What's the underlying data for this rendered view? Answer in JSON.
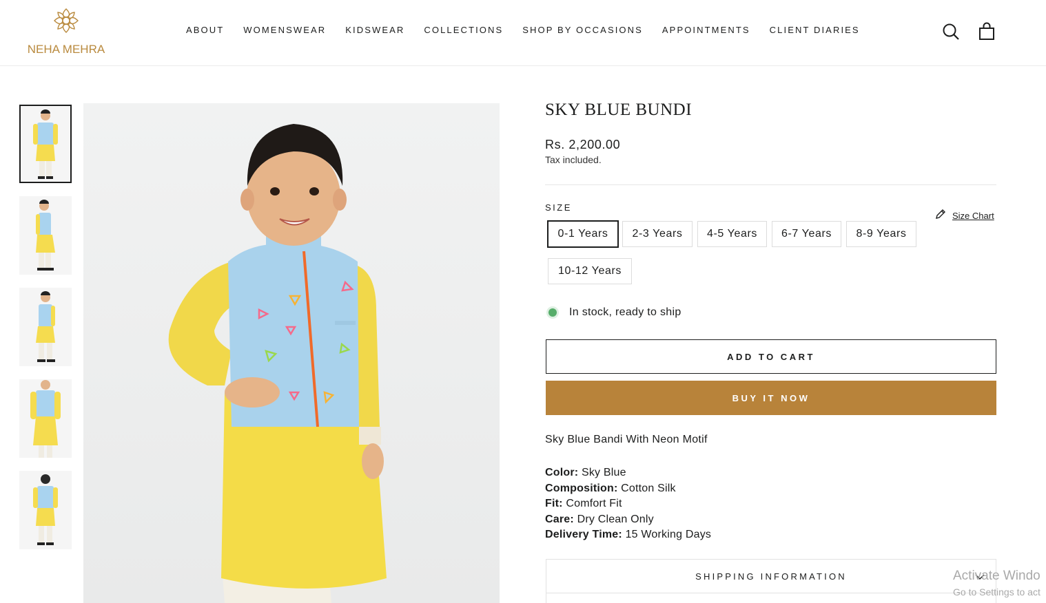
{
  "brand": {
    "name": "NEHA MEHRA",
    "accent": "#b8833a"
  },
  "nav": {
    "items": [
      "ABOUT",
      "WOMENSWEAR",
      "KIDSWEAR",
      "COLLECTIONS",
      "SHOP BY OCCASIONS",
      "APPOINTMENTS",
      "CLIENT DIARIES"
    ]
  },
  "header_icons": {
    "search": "search-icon",
    "cart": "cart-icon"
  },
  "gallery": {
    "thumbnail_count": 5,
    "active_index": 0
  },
  "product": {
    "title": "SKY BLUE BUNDI",
    "price": "Rs. 2,200.00",
    "tax_note": "Tax included.",
    "size_label": "SIZE",
    "size_chart_label": "Size Chart",
    "sizes": [
      "0-1 Years",
      "2-3 Years",
      "4-5 Years",
      "6-7 Years",
      "8-9 Years",
      "10-12 Years"
    ],
    "selected_size": "0-1 Years",
    "stock_text": "In stock, ready to ship",
    "stock_color": "#56ad6a",
    "add_to_cart_label": "ADD TO CART",
    "buy_now_label": "BUY IT NOW",
    "buy_now_color": "#b8833a",
    "description": "Sky Blue Bandi With Neon Motif",
    "details": [
      {
        "key": "Color:",
        "value": "Sky Blue"
      },
      {
        "key": "Composition:",
        "value": "Cotton Silk"
      },
      {
        "key": "Fit:",
        "value": "Comfort Fit"
      },
      {
        "key": "Care:",
        "value": "Dry Clean Only"
      },
      {
        "key": "Delivery Time:",
        "value": "15 Working Days"
      }
    ],
    "accordion_label": "SHIPPING INFORMATION"
  },
  "watermark": {
    "line1": "Activate Windo",
    "line2": "Go to Settings to act"
  }
}
